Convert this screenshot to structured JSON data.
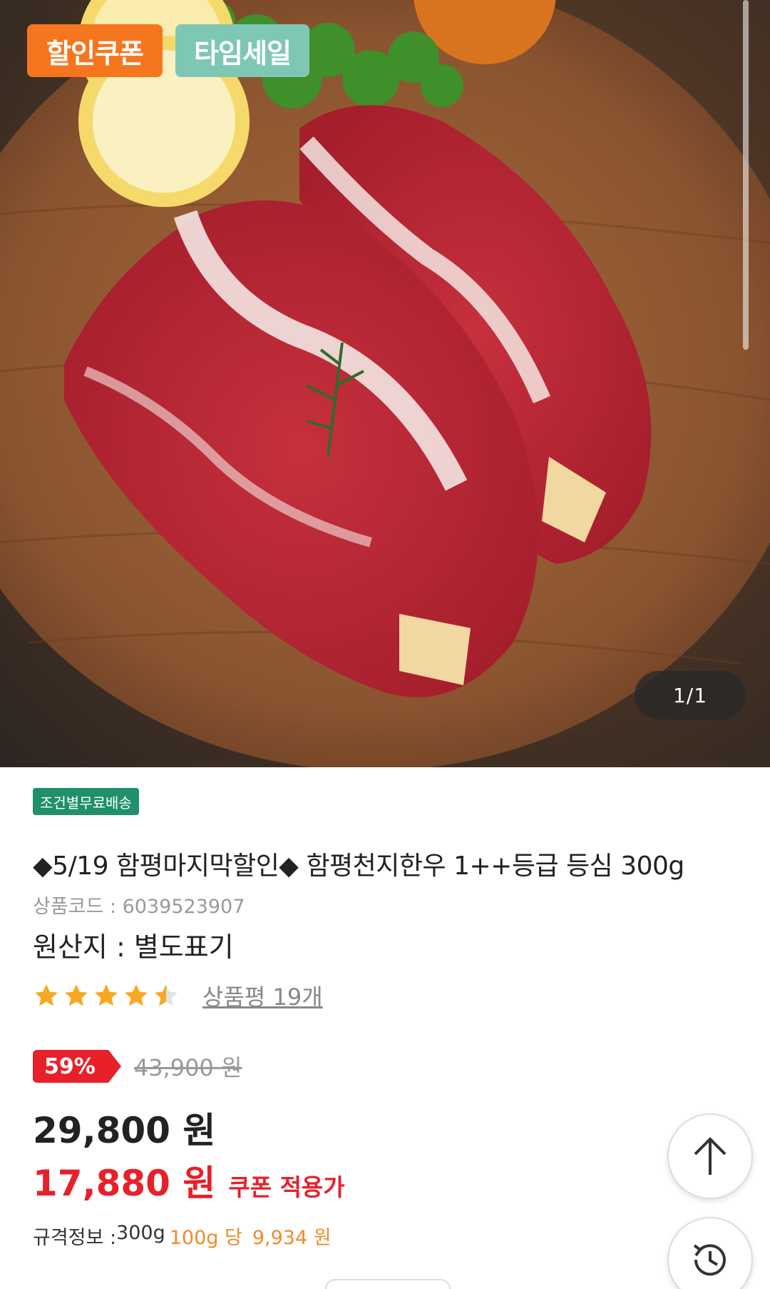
{
  "hero": {
    "badges": {
      "coupon": "할인쿠폰",
      "timesale": "타임세일"
    },
    "image_counter": "1/1",
    "image_alt": "marbled beef steak on wooden board"
  },
  "product": {
    "shipping_tag": "조건별무료배송",
    "title": "◆5/19 함평마지막할인◆ 함평천지한우 1++등급 등심 300g",
    "code_label": "상품코드 : ",
    "code_value": "6039523907",
    "origin_label": "원산지 : ",
    "origin_value": "별도표기",
    "rating": 4.5,
    "rating_max": 5,
    "review_link": "상품평 19개"
  },
  "pricing": {
    "discount_badge": "59%",
    "original_price": "43,900 원",
    "sale_price": "29,800 원",
    "coupon_price": "17,880 원",
    "coupon_label": "쿠폰 적용가",
    "spec_label": "규격정보 : ",
    "spec_value": "300g",
    "unit_label": "100g 당",
    "unit_price": "9,934 원"
  },
  "colors": {
    "coupon_badge": "#f5761f",
    "timesale_badge": "#7fc7b5",
    "shipping_tag": "#1f8f6c",
    "discount_red": "#e8202a",
    "unit_orange": "#f08a2b",
    "star": "#f7a823"
  },
  "fabs": {
    "scroll_top": "arrow-up-icon",
    "history": "history-icon"
  }
}
